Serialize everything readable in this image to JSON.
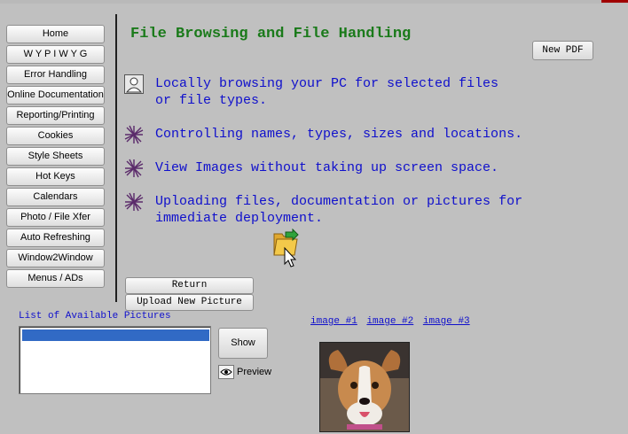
{
  "page": {
    "title": "File Browsing and File Handling"
  },
  "sidebar": {
    "items": [
      {
        "label": "Home"
      },
      {
        "label": "W Y P I W Y G"
      },
      {
        "label": "Error Handling"
      },
      {
        "label": "Online Documentation"
      },
      {
        "label": "Reporting/Printing"
      },
      {
        "label": "Cookies"
      },
      {
        "label": "Style Sheets"
      },
      {
        "label": "Hot Keys"
      },
      {
        "label": "Calendars"
      },
      {
        "label": "Photo / File Xfer"
      },
      {
        "label": "Auto Refreshing"
      },
      {
        "label": "Window2Window"
      },
      {
        "label": "Menus / ADs"
      }
    ]
  },
  "toolbar": {
    "new_pdf_label": "New PDF"
  },
  "features": [
    {
      "text": "Locally browsing your PC for selected files\nor file types.",
      "icon": "user-icon"
    },
    {
      "text": "Controlling names, types, sizes and locations.",
      "icon": "spark-icon"
    },
    {
      "text": "View Images without taking up screen space.",
      "icon": "spark-icon"
    },
    {
      "text": "Uploading files, documentation or pictures for\nimmediate deployment.",
      "icon": "spark-icon"
    }
  ],
  "actions": {
    "return_label": "Return",
    "upload_label": "Upload New Picture"
  },
  "pictures": {
    "list_label": "List of Available Pictures",
    "show_label": "Show",
    "preview_label": "Preview",
    "links": [
      {
        "label": "image #1"
      },
      {
        "label": "image #2"
      },
      {
        "label": "image #3"
      }
    ]
  },
  "colors": {
    "title": "#1a7a1a",
    "feature_text": "#0f0fcc",
    "link": "#1010cc",
    "selection": "#316ac5"
  }
}
